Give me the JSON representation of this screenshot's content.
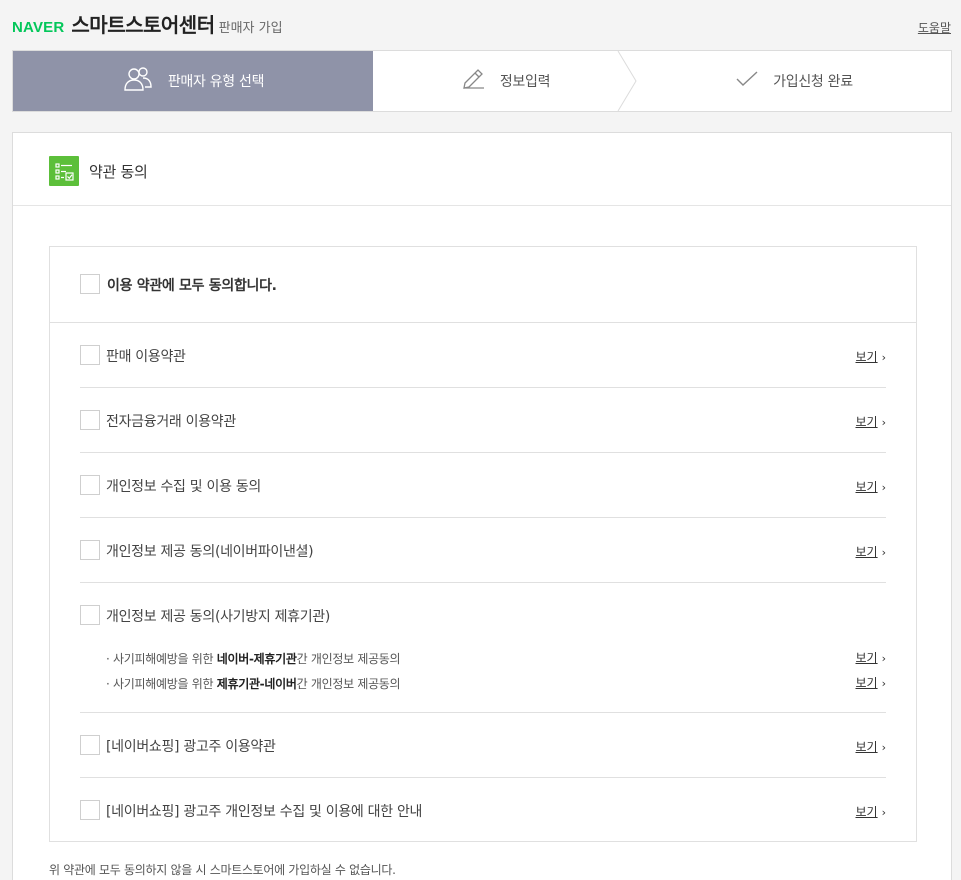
{
  "header": {
    "logo": "NAVER",
    "service_name": "스마트스토어센터",
    "page_sub": "판매자 가입",
    "help": "도움말"
  },
  "steps": [
    {
      "label": "판매자 유형 선택",
      "icon": "users-icon",
      "active": true
    },
    {
      "label": "정보입력",
      "icon": "pencil-icon",
      "active": false
    },
    {
      "label": "가입신청 완료",
      "icon": "check-icon",
      "active": false
    }
  ],
  "panel": {
    "title": "약관 동의",
    "agree_all": "이용 약관에 모두 동의합니다.",
    "view_label": "보기",
    "terms": [
      {
        "label": "판매 이용약관"
      },
      {
        "label": "전자금융거래 이용약관"
      },
      {
        "label": "개인정보 수집 및 이용 동의"
      },
      {
        "label": "개인정보 제공 동의(네이버파이낸셜)"
      },
      {
        "label": "개인정보 제공 동의(사기방지 제휴기관)"
      },
      {
        "label": "[네이버쇼핑] 광고주 이용약관"
      },
      {
        "label": "[네이버쇼핑] 광고주 개인정보 수집 및 이용에 대한 안내"
      }
    ],
    "fraud_subitems": [
      {
        "prefix": "· 사기피해예방을 위한 ",
        "bold": "네이버-제휴기관",
        "suffix": "간 개인정보 제공동의"
      },
      {
        "prefix": "· 사기피해예방을 위한 ",
        "bold": "제휴기관-네이버",
        "suffix": "간 개인정보 제공동의"
      }
    ],
    "footnote": "위 약관에 모두 동의하지 않을 시 스마트스토어에 가입하실 수 없습니다."
  },
  "colors": {
    "brand_green": "#03c75a",
    "active_step": "#8f93a8",
    "terms_icon": "#5cbf3a"
  }
}
